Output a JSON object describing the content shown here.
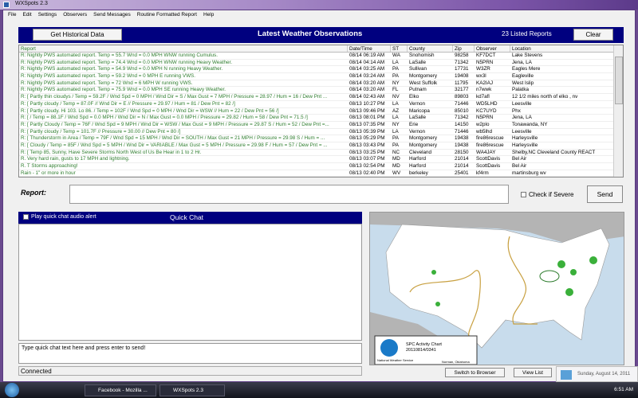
{
  "window": {
    "title": "WXSpots 2.3"
  },
  "menu": [
    "File",
    "Edit",
    "Settings",
    "Observers",
    "Send Messages",
    "Routine Formatted Report",
    "Help"
  ],
  "panel": {
    "historical_button": "Get Historical Data",
    "title": "Latest Weather Observations",
    "count": "23  Listed Reports",
    "clear_button": "Clear"
  },
  "table": {
    "columns": [
      "Report",
      "Date/Time",
      "ST",
      "County",
      "Zip",
      "Observer",
      "Location"
    ],
    "rows": [
      [
        "R: Nightly PWS automated report. Temp = 55.7  Wnd = 0.0 MPH WNW running Cumulus.",
        "08/14 06:19 AM",
        "WA",
        "Snohomish",
        "98258",
        "KF7DCT",
        "Lake Stevens"
      ],
      [
        "R: Nightly PWS automated report. Temp = 74.4  Wnd = 0.0 MPH WNW running Heavy Weather.",
        "08/14 04:14 AM",
        "LA",
        "LaSalle",
        "71342",
        "N5PRN",
        "Jena, LA"
      ],
      [
        "R: Nightly PWS automated report. Temp = 54.9  Wnd = 0.0 MPH N running Heavy Weather.",
        "08/14 03:25 AM",
        "PA",
        "Sullivan",
        "17731",
        "W3ZR",
        "Eagles Mere"
      ],
      [
        "R: Nightly PWS automated report. Temp = 59.2  Wnd = 0 MPH E running VWS.",
        "08/14 03:24 AM",
        "PA",
        "Montgomery",
        "19408",
        "wx3l",
        "Eagleville"
      ],
      [
        "R: Nightly PWS automated report. Temp = 72  Wnd = 6 MPH W running VWS.",
        "08/14 03:20 AM",
        "NY",
        "West Suffolk",
        "11795",
        "KA2IAJ",
        "West Islip"
      ],
      [
        "R: Nightly PWS automated report. Temp = 75.9  Wnd = 0.0 MPH SE running Heavy Weather.",
        "08/14 03:20 AM",
        "FL",
        "Putnam",
        "32177",
        "n7wwk",
        "Palatka"
      ],
      [
        "R: [ Partly thin cloudys / Temp = 59.2F / Wnd Spd = 0 MPH / Wnd Dir = S / Max Gust = 7 MPH / Pressure = 28.97 / Hum = 16 / Dew Pnt ...",
        "08/14 02:43 AM",
        "NV",
        "Elko",
        "89803",
        "kd7afl",
        "12 1/2 miles north of elko , nv"
      ],
      [
        "R: [ Partly cloudy / Temp = 87.0F // Wnd Dir = E // Pressure = 29.97 / Hum = 81 / Dew Pnt = 82 /]",
        "08/13 10:27 PM",
        "LA",
        "Vernon",
        "71446",
        "WD5LHD",
        "Leesville"
      ],
      [
        "R: [ Partly cloudy.  Hi 103. Lo 86. / Temp = 102F / Wnd Spd = 0 MPH / Wnd Dir = WSW // Hum = 22 / Dew Pnt = 56 /]",
        "08/13 09:46 PM",
        "AZ",
        "Maricopa",
        "85010",
        "KC7UYD",
        "Phx"
      ],
      [
        "R: [  / Temp = 88.1F / Wnd Spd = 0.0 MPH / Wnd Dir = N / Max Gust = 0.0 MPH / Pressure = 29.82 / Hum = 58 / Dew Pnt = 71.5 /]",
        "08/13 08:01 PM",
        "LA",
        "LaSalle",
        "71342",
        "N5PRN",
        "Jena, LA"
      ],
      [
        "R: [ Partly Cloudy / Temp = 76F / Wnd Spd = 9 MPH / Wnd Dir = WSW / Max Gust = 9 MPH / Pressure = 29.87 S / Hum = 52 / Dew Pnt =...",
        "08/13 07:35 PM",
        "NY",
        "Erie",
        "14150",
        "w2plo",
        "Tonawanda, NY"
      ],
      [
        "R: [ Partly cloudy / Temp = 101.7F // Pressure = 30.00 // Dew Pnt = 80 /]",
        "08/13 05:39 PM",
        "LA",
        "Vernon",
        "71446",
        "wb5lhd",
        "Leesville"
      ],
      [
        "R: [ Thunderstorm in Area / Temp = 79F / Wnd Spd = 15 MPH / Wnd Dir = SOUTH / Max Gust = 21 MPH / Pressure = 29.98 S / Hum = ...",
        "08/13 05:29 PM",
        "PA",
        "Montgomery",
        "19438",
        "fire86rescue",
        "Harleysville"
      ],
      [
        "R: [ Cloudy / Temp = 85F / Wnd Spd = 5 MPH / Wnd Dir = VARIABLE / Max Gust = 5 MPH / Pressure = 29.98 F / Hum = 57 / Dew Pnt = ...",
        "08/13 03:43 PM",
        "PA",
        "Montgomery",
        "19438",
        "fire86rescue",
        "Harleysville"
      ],
      [
        "R: [ Temp 85, Sunny, Have Severe Storms North West of Us Be Hear in 1 to 2 Hr.",
        "08/13 03:25 PM",
        "NC",
        "Cleveland",
        "28150",
        "WA4JAY",
        "Shelby,NC   Cleveland County REACT"
      ],
      [
        "R. Very hard rain, gusts to 17 MPH and lightning.",
        "08/13 03:07 PM",
        "MD",
        "Harford",
        "21014",
        "ScottDavis",
        "Bel Air"
      ],
      [
        "R. T Storms approaching!",
        "08/13 02:54 PM",
        "MD",
        "Harford",
        "21014",
        "ScottDavis",
        "Bel Air"
      ],
      [
        "Rain - 1\" or more in hour",
        "08/13 02:40 PM",
        "WV",
        "berkeley",
        "25401",
        "kf4rm",
        "martinsburg wv"
      ]
    ]
  },
  "report": {
    "label": "Report:",
    "value": "",
    "severe_label": "Check if Severe",
    "send_button": "Send"
  },
  "quick_chat": {
    "audio_alert_label": "Play quick chat audio alert",
    "title": "Quick Chat",
    "input_placeholder": "Type quick chat text here and press enter to send!"
  },
  "status": "Connected",
  "map": {
    "title": "SPC Activity Chart",
    "timestamp": "20110814/0341",
    "credit": "National Weather Service",
    "place": "Norman, Oklahoma",
    "logo": "NOAA"
  },
  "buttons": {
    "switch_browser": "Switch to Browser",
    "view_list": "View List"
  },
  "notification": "Sunday, August 14, 2011",
  "taskbar": {
    "items": [
      "Facebook - Mozilla ...",
      "WXSpots 2.3"
    ],
    "clock": "6:51 AM"
  }
}
